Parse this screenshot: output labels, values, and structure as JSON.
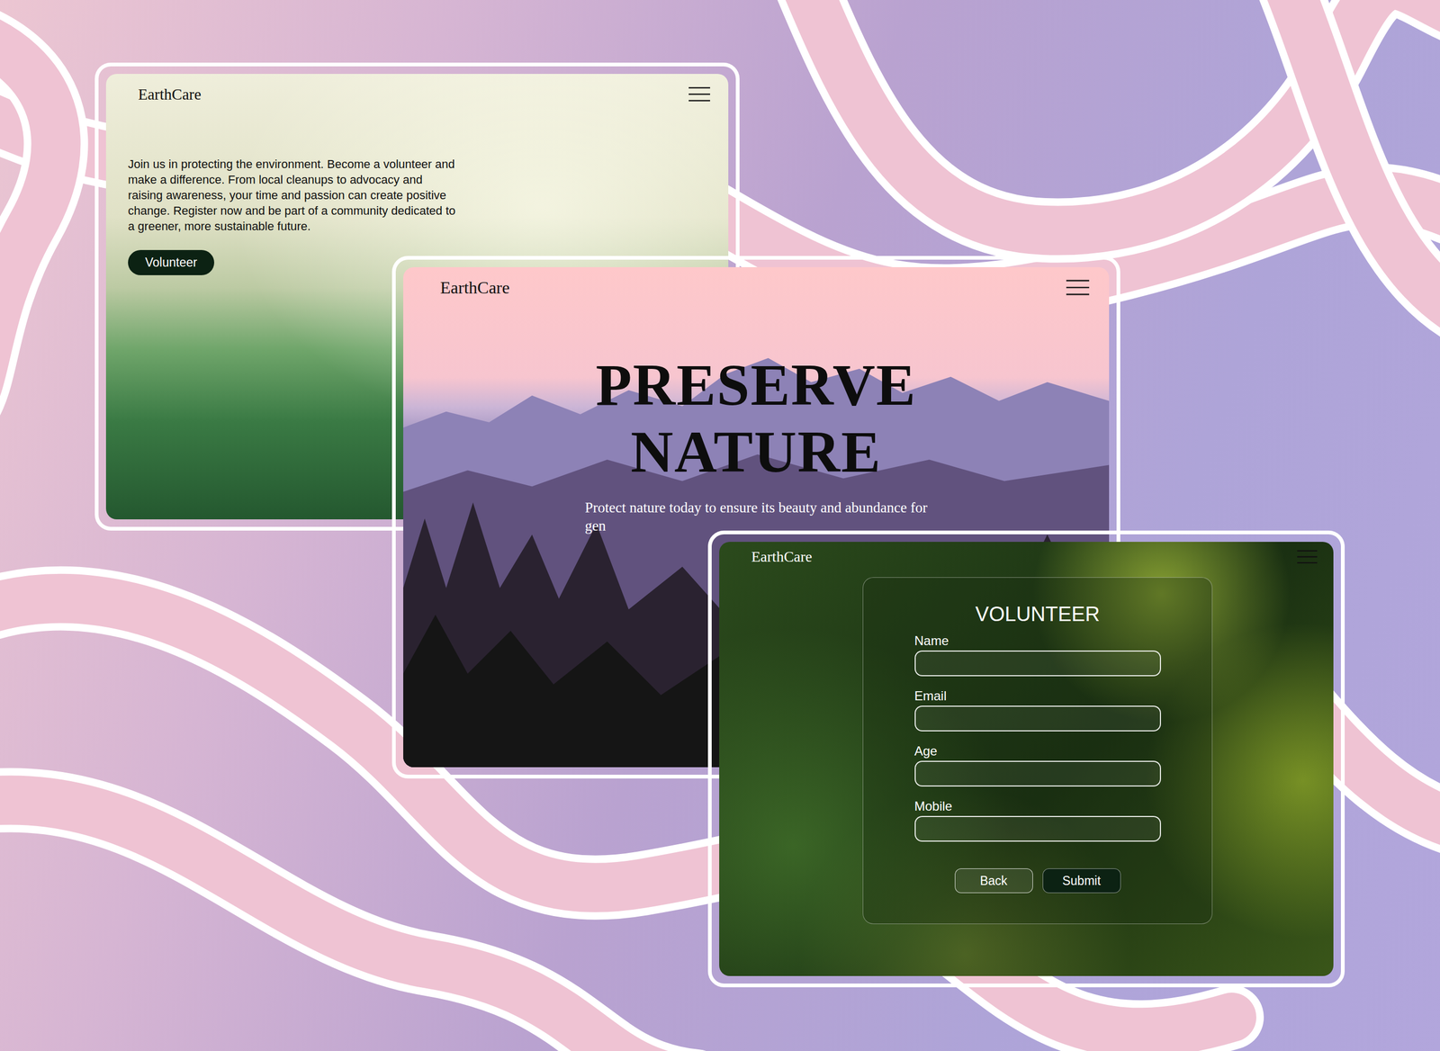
{
  "landing": {
    "brand": "EarthCare",
    "intro": "Join us in protecting the environment. Become a volunteer and make a difference. From local cleanups to advocacy and raising awareness, your time and passion can create positive change. Register now and be part of a community dedicated to a greener, more sustainable future.",
    "button": "Volunteer"
  },
  "hero": {
    "brand": "EarthCare",
    "title": [
      "PRESERVE",
      "NATURE"
    ],
    "subtitle": [
      "Protect nature today to ensure its beauty and abundance for",
      "gen"
    ]
  },
  "form": {
    "brand": "EarthCare",
    "title": "VOLUNTEER",
    "fields": [
      {
        "label": "Name",
        "value": ""
      },
      {
        "label": "Email",
        "value": ""
      },
      {
        "label": "Age",
        "value": ""
      },
      {
        "label": "Mobile",
        "value": ""
      }
    ],
    "buttons": [
      {
        "label": "Back",
        "kind": "secondary"
      },
      {
        "label": "Submit",
        "kind": "primary"
      }
    ]
  }
}
